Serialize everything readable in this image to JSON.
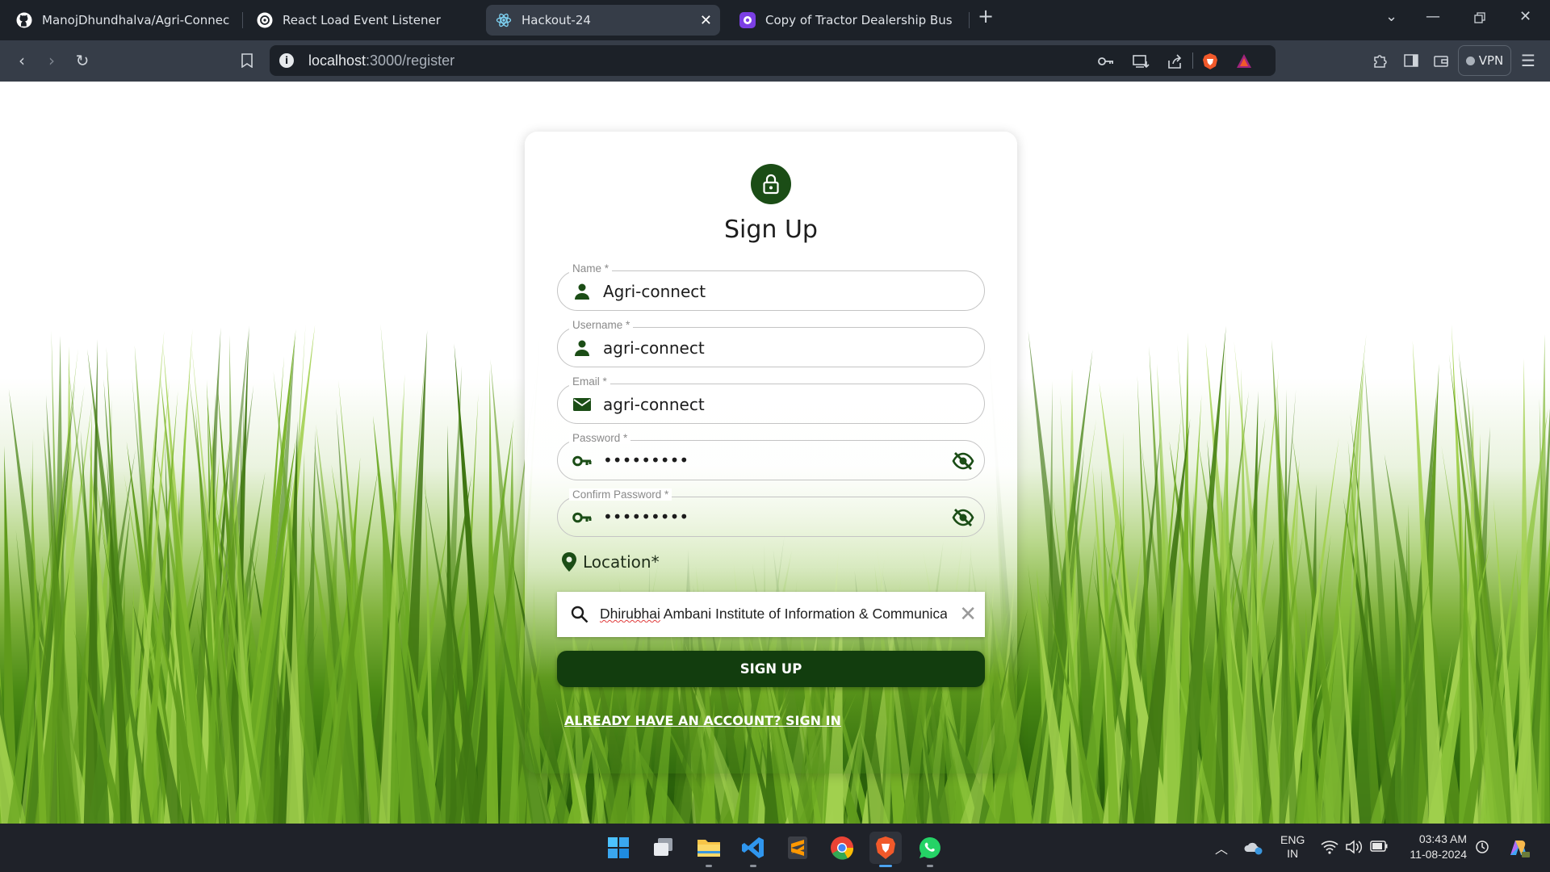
{
  "browser": {
    "tabs": [
      {
        "title": "ManojDhundhalva/Agri-Connect: H",
        "icon": "github-icon",
        "active": false
      },
      {
        "title": "React Load Event Listener",
        "icon": "chatgpt-icon",
        "active": false
      },
      {
        "title": "Hackout-24",
        "icon": "react-icon",
        "active": true
      },
      {
        "title": "Copy of Tractor Dealership Business",
        "icon": "canva-icon",
        "active": false
      }
    ],
    "new_tab_icon": "plus-icon",
    "url_host": "localhost",
    "url_path": ":3000/register",
    "vpn_label": "VPN"
  },
  "form": {
    "title": "Sign Up",
    "fields": [
      {
        "label": "Name *",
        "value": "Agri-connect",
        "icon": "person-icon"
      },
      {
        "label": "Username *",
        "value": "agri-connect",
        "icon": "person-icon"
      },
      {
        "label": "Email *",
        "value": "agri-connect",
        "icon": "mail-icon"
      },
      {
        "label": "Password *",
        "value": "•••••••••",
        "icon": "key-icon"
      },
      {
        "label": "Confirm Password *",
        "value": "•••••••••",
        "icon": "key-icon"
      }
    ],
    "location_label": "Location*",
    "location_search_value_a": "Dhirubhai",
    "location_search_value_b": " Ambani Institute of Information & Communica",
    "submit_label": "SIGN UP",
    "signin_link": "ALREADY HAVE AN ACCOUNT? SIGN IN"
  },
  "taskbar": {
    "apps": [
      "windows-start-icon",
      "task-view-icon",
      "file-explorer-icon",
      "vscode-icon",
      "sublime-text-icon",
      "chrome-icon",
      "brave-icon",
      "whatsapp-icon"
    ],
    "language_top": "ENG",
    "language_bottom": "IN",
    "time": "03:43 AM",
    "date": "11-08-2024"
  },
  "colors": {
    "accent": "#1b4d16",
    "button": "#123d0e",
    "browser_chrome": "#1c2128",
    "toolbar": "#363d48"
  }
}
